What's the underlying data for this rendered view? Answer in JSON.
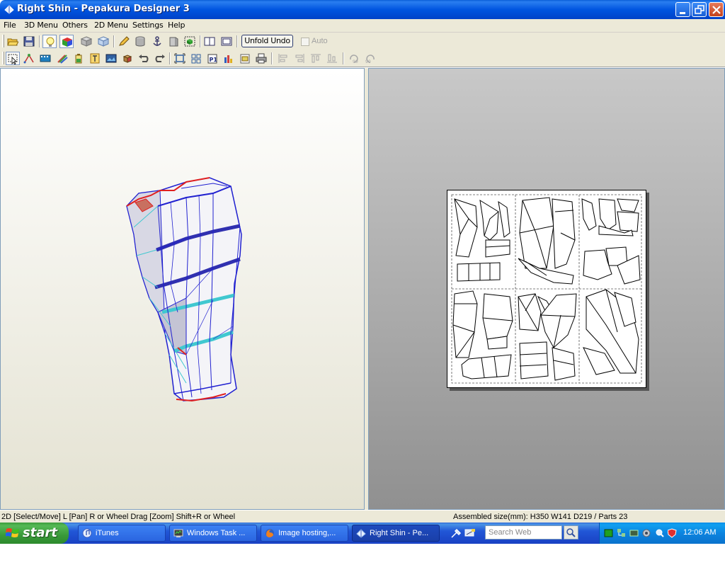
{
  "window": {
    "title": "Right Shin - Pepakura Designer 3"
  },
  "menu": [
    "File",
    "3D Menu",
    "Others",
    "2D Menu",
    "Settings",
    "Help"
  ],
  "toolbar": {
    "unfold_undo_label": "Unfold Undo",
    "auto_label": "Auto",
    "auto_checked": false
  },
  "status": {
    "left": "2D [Select/Move] L [Pan] R or Wheel Drag [Zoom] Shift+R or Wheel",
    "right": "Assembled size(mm): H350 W141 D219 / Parts 23"
  },
  "taskbar": {
    "start_label": "start",
    "tasks": [
      {
        "label": "iTunes",
        "icon": "itunes-icon"
      },
      {
        "label": "Windows Task ...",
        "icon": "task-manager-icon"
      },
      {
        "label": "Image hosting,...",
        "icon": "firefox-icon"
      },
      {
        "label": "Right Shin - Pe...",
        "icon": "pepakura-icon",
        "active": true
      }
    ],
    "search_placeholder": "Search Web",
    "clock": "12:06 AM"
  },
  "colors": {
    "titlebar": "#0055e0",
    "chrome": "#ece9d8",
    "start_green": "#3a9a3a",
    "model_edge_blue": "#2020d0",
    "model_edge_red": "#e02020",
    "model_edge_cyan": "#40c8d0"
  }
}
